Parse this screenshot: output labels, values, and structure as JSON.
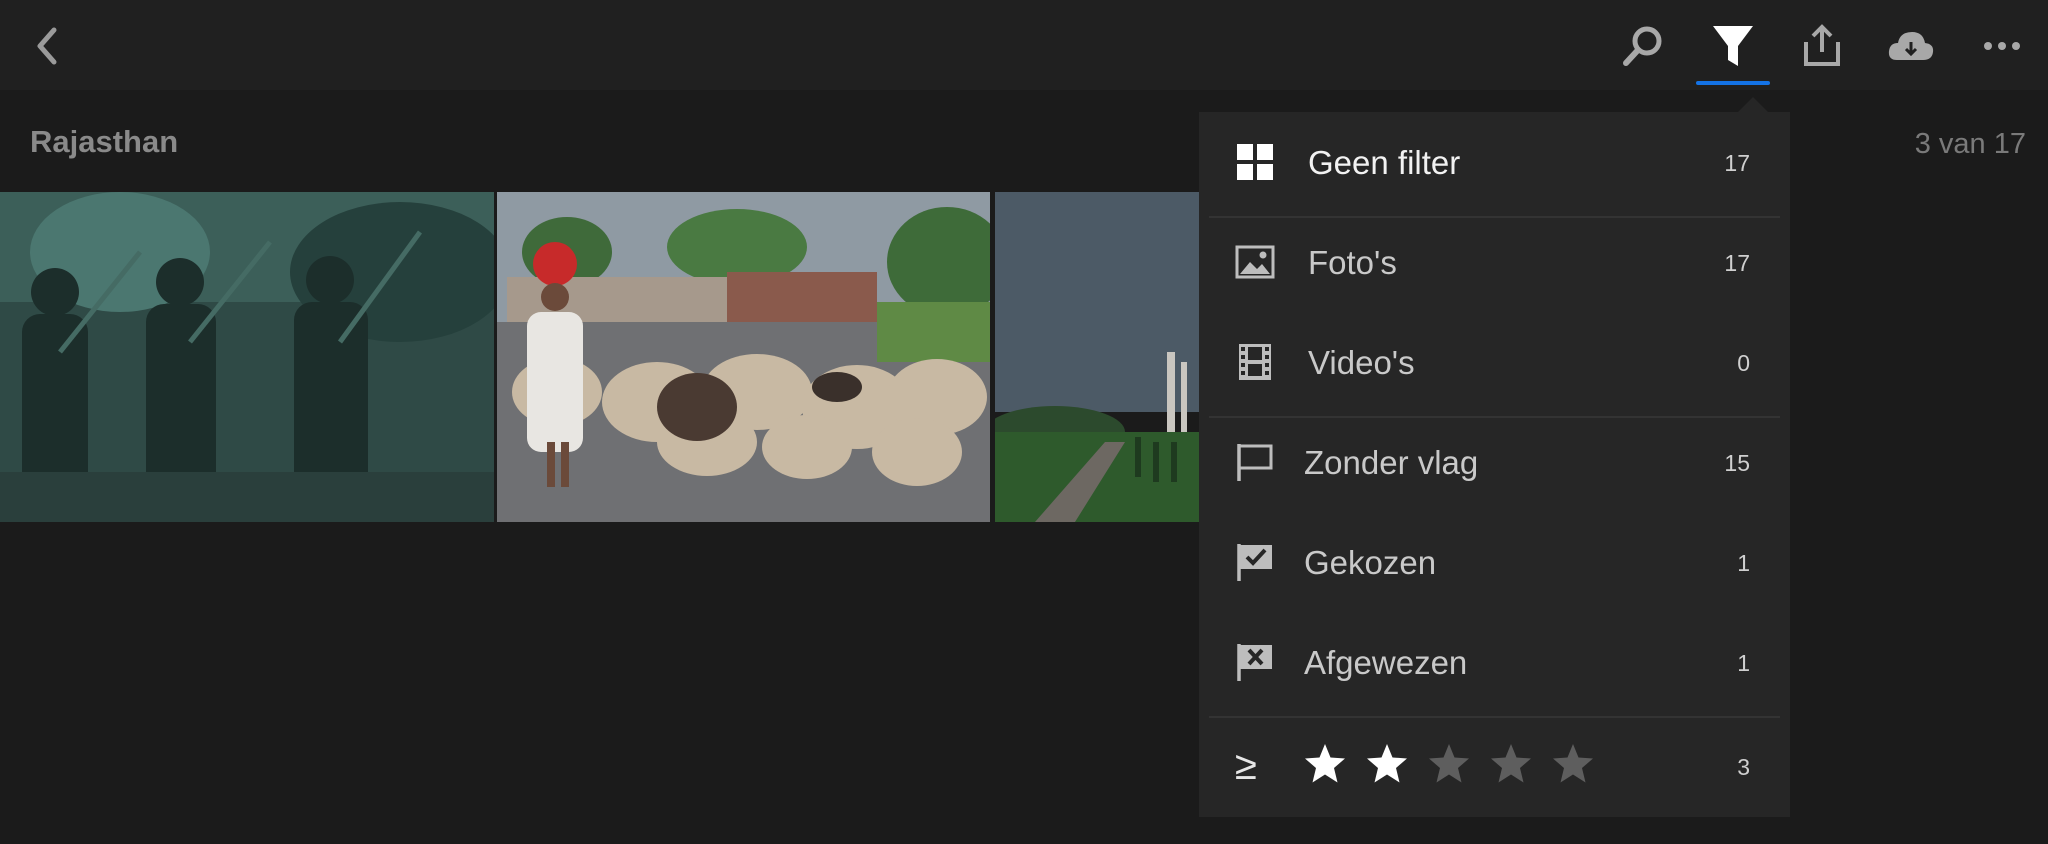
{
  "header": {
    "back_icon": "chevron-left-icon",
    "icons": [
      "search-icon",
      "filter-icon",
      "share-icon",
      "cloud-icon",
      "more-icon"
    ]
  },
  "album": {
    "title": "Rajasthan",
    "counter": "3 van 17"
  },
  "photos": [
    {
      "subject": "pipers-teal-toned"
    },
    {
      "subject": "shepherd-with-sheep"
    },
    {
      "subject": "taj-mahal-garden"
    }
  ],
  "filter_menu": {
    "items": [
      {
        "icon": "grid-icon",
        "label": "Geen filter",
        "count": "17",
        "selected": true
      },
      {
        "icon": "image-icon",
        "label": "Foto's",
        "count": "17"
      },
      {
        "icon": "film-icon",
        "label": "Video's",
        "count": "0"
      },
      {
        "icon": "flag-outline-icon",
        "label": "Zonder vlag",
        "count": "15"
      },
      {
        "icon": "flag-check-icon",
        "label": "Gekozen",
        "count": "1"
      },
      {
        "icon": "flag-reject-icon",
        "label": "Afgewezen",
        "count": "1"
      }
    ],
    "rating": {
      "operator": "≥",
      "stars": 2,
      "max": 5,
      "count": "3"
    }
  },
  "colors": {
    "accent": "#1473e6",
    "background": "#1b1b1b",
    "topbar": "#202020",
    "menu": "#262626"
  }
}
